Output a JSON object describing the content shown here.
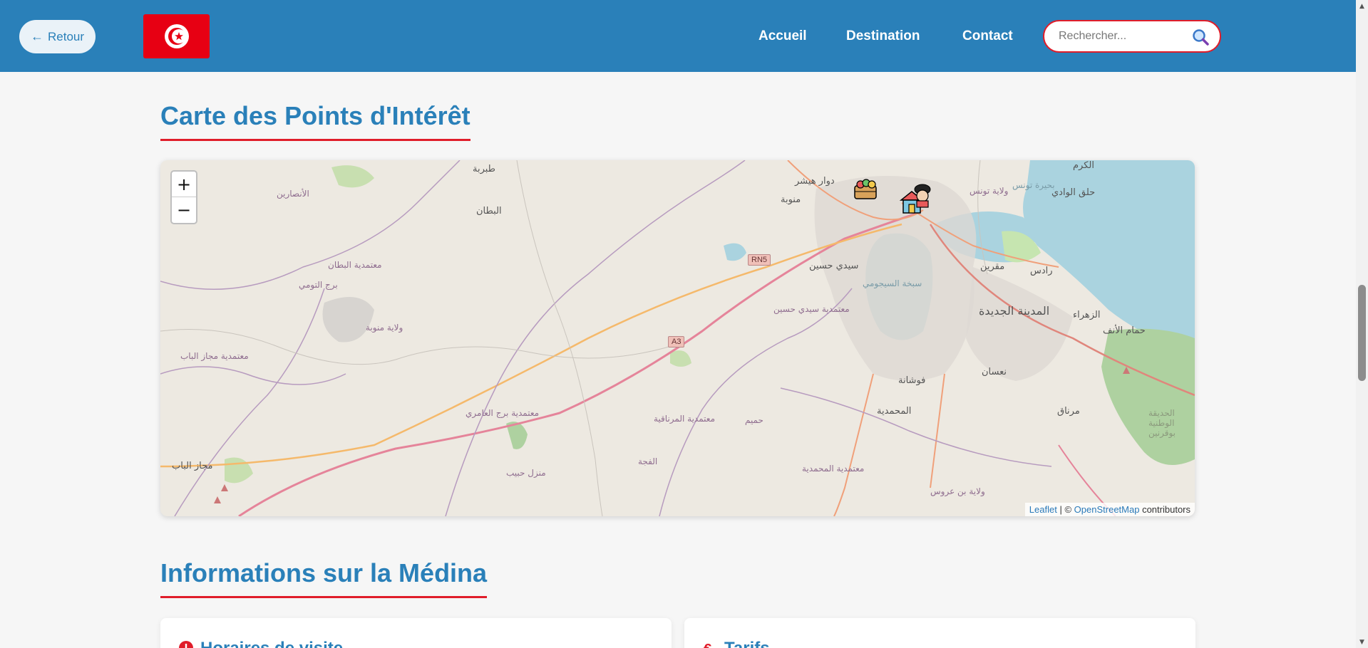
{
  "header": {
    "back_label": "Retour",
    "nav": [
      "Accueil",
      "Destination",
      "Contact"
    ],
    "search_placeholder": "Rechercher...",
    "brand_color": "#2a80b9",
    "accent_color": "#e01d2a"
  },
  "map_section": {
    "title": "Carte des Points d'Intérêt",
    "zoom_in": "+",
    "zoom_out": "−",
    "attribution": {
      "leaflet": "Leaflet",
      "separator": "| ©",
      "osm": "OpenStreetMap",
      "suffix": "contributors"
    },
    "places": [
      "طبربة",
      "البطان",
      "الأنصارين",
      "معتمدية البطان",
      "برج التومي",
      "ولاية منوبة",
      "معتمدية مجاز الباب",
      "مجاز الباب",
      "معتمدية برج العامري",
      "منزل حبيب",
      "الفجة",
      "معتمدية المرناقية",
      "حميم",
      "منوبة",
      "دوار هيشر",
      "ولاية تونس",
      "حلق الوادي",
      "الكرم",
      "سيدي حسين",
      "معتمدية سيدي حسين",
      "سبخة السيجومي",
      "مقرين",
      "رادس",
      "المدينة الجديدة",
      "الزهراء",
      "حمام الأنف",
      "فوشانة",
      "المحمدية",
      "نعسان",
      "مرناق",
      "معتمدية المحمدية",
      "ولاية بن عروس",
      "الحديقة الوطنية بوقرنين",
      "بحيرة تونس"
    ],
    "road_labels": [
      "RN5",
      "A3"
    ],
    "markers": [
      "market-marker",
      "house-marker",
      "chef-marker"
    ]
  },
  "info_section": {
    "title": "Informations sur la Médina",
    "cards": [
      {
        "title": "Horaires de visite",
        "icon": "alert-circle-icon"
      },
      {
        "title": "Tarifs",
        "icon": "euro-icon"
      }
    ]
  }
}
